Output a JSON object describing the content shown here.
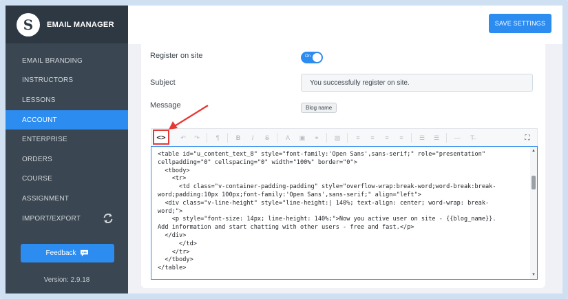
{
  "app": {
    "title": "EMAIL MANAGER",
    "logo_letter": "S"
  },
  "sidebar": {
    "items": [
      {
        "label": "EMAIL BRANDING",
        "active": false
      },
      {
        "label": "INSTRUCTORS",
        "active": false
      },
      {
        "label": "LESSONS",
        "active": false
      },
      {
        "label": "ACCOUNT",
        "active": true
      },
      {
        "label": "ENTERPRISE",
        "active": false
      },
      {
        "label": "ORDERS",
        "active": false
      },
      {
        "label": "COURSE",
        "active": false
      },
      {
        "label": "ASSIGNMENT",
        "active": false
      },
      {
        "label": "IMPORT/EXPORT",
        "active": false,
        "icon": "sync-icon"
      }
    ],
    "feedback_label": "Feedback",
    "version": "Version: 2.9.18"
  },
  "header": {
    "save_label": "SAVE SETTINGS"
  },
  "form": {
    "register_label": "Register on site",
    "toggle_text": "On",
    "toggle_on": true,
    "subject_label": "Subject",
    "subject_value": "You successfully register on site.",
    "message_label": "Message",
    "tag_label": "Blog name"
  },
  "editor": {
    "code_view_icon": "code-view-icon",
    "toolbar_icons": [
      "undo-icon",
      "redo-icon",
      "paragraph-icon",
      "bold-icon",
      "italic-icon",
      "strikethrough-icon",
      "font-color-icon",
      "background-color-icon",
      "link-icon",
      "image-icon",
      "align-left-icon",
      "align-center-icon",
      "align-right-icon",
      "align-justify-icon",
      "bullet-list-icon",
      "numbered-list-icon",
      "horizontal-rule-icon",
      "clear-format-icon",
      "fullscreen-icon"
    ],
    "code_lines": [
      "<table id=\"u_content_text_8\" style=\"font-family:'Open Sans',sans-serif;\" role=\"presentation\"",
      "cellpadding=\"0\" cellspacing=\"0\" width=\"100%\" border=\"0\">",
      "  <tbody>",
      "    <tr>",
      "      <td class=\"v-container-padding-padding\" style=\"overflow-wrap:break-word;word-break:break-",
      "word;padding:10px 100px;font-family:'Open Sans',sans-serif;\" align=\"left\">",
      "",
      "  <div class=\"v-line-height\" style=\"line-height:| 140%; text-align: center; word-wrap: break-",
      "word;\">",
      "    <p style=\"font-size: 14px; line-height: 140%;\">Now you active user on site - {{blog_name}}.",
      "Add information and start chatting with other users - free and fast.</p>",
      "  </div>",
      "",
      "      </td>",
      "    </tr>",
      "  </tbody>",
      "</table>"
    ]
  },
  "colors": {
    "accent": "#2d8cf0",
    "sidebar_bg": "#3a4651",
    "highlight": "#e53935"
  }
}
